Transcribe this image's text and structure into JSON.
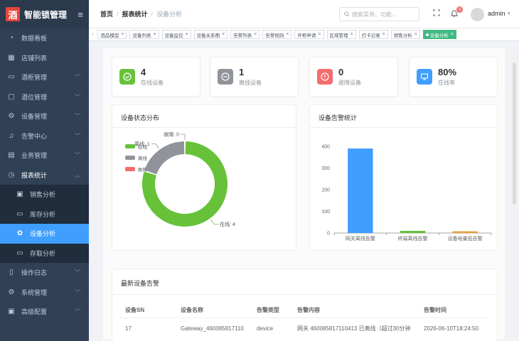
{
  "brand": {
    "logo": "酒",
    "title": "智能锁管理",
    "toggle_icon": "hamburger-icon"
  },
  "sidebar": {
    "items": [
      {
        "label": "数据看板",
        "icon": "dashboard-icon",
        "arrow": false
      },
      {
        "label": "店铺列表",
        "icon": "shop-icon",
        "arrow": false
      },
      {
        "label": "酒柜管理",
        "icon": "cabinet-icon",
        "arrow": true
      },
      {
        "label": "酒位管理",
        "icon": "slot-icon",
        "arrow": true
      },
      {
        "label": "设备管理",
        "icon": "device-icon",
        "arrow": true
      },
      {
        "label": "告警中心",
        "icon": "bell-icon",
        "arrow": true
      },
      {
        "label": "业务管理",
        "icon": "business-icon",
        "arrow": true
      },
      {
        "label": "报表统计",
        "icon": "report-icon",
        "arrow": true,
        "open": true
      },
      {
        "label": "销售分析",
        "icon": "sales-icon",
        "sub": true
      },
      {
        "label": "库存分析",
        "icon": "stock-icon",
        "sub": true
      },
      {
        "label": "设备分析",
        "icon": "device-analysis-icon",
        "sub": true,
        "active": true
      },
      {
        "label": "存取分析",
        "icon": "access-icon",
        "sub": true
      },
      {
        "label": "操作日志",
        "icon": "log-icon",
        "arrow": true
      },
      {
        "label": "系统管理",
        "icon": "gear-icon",
        "arrow": true
      },
      {
        "label": "高级配置",
        "icon": "lock-icon",
        "arrow": true
      }
    ]
  },
  "header": {
    "breadcrumb": [
      "首页",
      "报表统计",
      "设备分析"
    ],
    "search_placeholder": "搜索菜单、功能...",
    "notification_count": "3",
    "username": "admin"
  },
  "tags": [
    {
      "label": "酒品模型",
      "active": false
    },
    {
      "label": "设备列表",
      "active": false
    },
    {
      "label": "设备监控",
      "active": false
    },
    {
      "label": "设备关系图",
      "active": false
    },
    {
      "label": "告警列表",
      "active": false
    },
    {
      "label": "告警规则",
      "active": false
    },
    {
      "label": "开柜申请",
      "active": false
    },
    {
      "label": "区域管理",
      "active": false
    },
    {
      "label": "打卡记录",
      "active": false
    },
    {
      "label": "销售分析",
      "active": false
    },
    {
      "label": "设备分析",
      "active": true
    }
  ],
  "stats": [
    {
      "value": "4",
      "label": "在线设备",
      "color": "#67c23a",
      "icon": "check-circle-icon"
    },
    {
      "value": "1",
      "label": "离线设备",
      "color": "#909399",
      "icon": "minus-circle-icon"
    },
    {
      "value": "0",
      "label": "故障设备",
      "color": "#f56c6c",
      "icon": "alert-circle-icon"
    },
    {
      "value": "80%",
      "label": "在线率",
      "color": "#409eff",
      "icon": "monitor-icon"
    }
  ],
  "status_panel": {
    "title": "设备状态分布"
  },
  "alarm_panel": {
    "title": "设备告警统计"
  },
  "chart_data": [
    {
      "type": "pie",
      "title": "设备状态分布",
      "labels": [
        "在线",
        "离线",
        "故障"
      ],
      "values": [
        4,
        1,
        0
      ],
      "colors": [
        "#67c23a",
        "#909399",
        "#f56c6c"
      ],
      "slice_labels": [
        "在线: 4",
        "离线: 1",
        "故障: 0"
      ],
      "legend": "top-left",
      "donut": true
    },
    {
      "type": "bar",
      "title": "设备告警统计",
      "categories": [
        "网关离线告警",
        "终端离线告警",
        "设备电量低告警"
      ],
      "values": [
        390,
        10,
        8
      ],
      "colors": [
        "#409eff",
        "#67c23a",
        "#e6a23c"
      ],
      "ylim": [
        0,
        400
      ],
      "yticks": [
        "0",
        "100",
        "200",
        "300",
        "400"
      ],
      "grid": false
    }
  ],
  "alerts": {
    "title": "最新设备告警",
    "columns": [
      "设备SN",
      "设备名称",
      "告警类型",
      "告警内容",
      "告警时间"
    ],
    "rows": [
      [
        "17",
        "Gateway_460085817110",
        "device",
        "网关 460085817110413 已离线（超过30分钟",
        "2026-06-10T18:24:50"
      ]
    ]
  }
}
